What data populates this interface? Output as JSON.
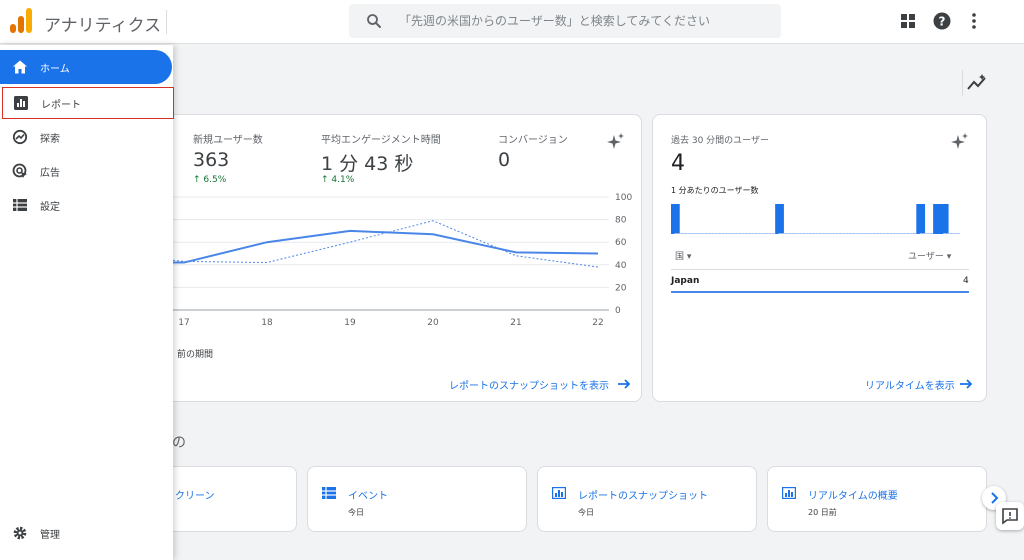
{
  "header": {
    "app_title": "アナリティクス",
    "search_placeholder": "「先週の米国からのユーザー数」と検索してみてください",
    "icons": [
      "apps-grid-icon",
      "help-icon",
      "more-vert-icon"
    ]
  },
  "sidebar": {
    "items": [
      {
        "label": "ホーム",
        "icon": "home-icon",
        "active": true
      },
      {
        "label": "レポート",
        "icon": "reports-icon",
        "highlighted": true
      },
      {
        "label": "探索",
        "icon": "explore-icon"
      },
      {
        "label": "広告",
        "icon": "advertising-icon"
      },
      {
        "label": "設定",
        "icon": "configure-icon"
      }
    ],
    "admin_label": "管理"
  },
  "overview_card": {
    "metrics": [
      {
        "label": "新規ユーザー数",
        "value": "363",
        "delta": "6.5%"
      },
      {
        "label": "平均エンゲージメント時間",
        "value": "1 分 43 秒",
        "delta": "4.1%"
      },
      {
        "label": "コンバージョン",
        "value": "0"
      }
    ],
    "legend_previous": "前の期間",
    "link": "レポートのスナップショットを表示"
  },
  "chart_data": {
    "type": "line",
    "x": [
      "17",
      "18",
      "19",
      "20",
      "21",
      "22"
    ],
    "y_ticks": [
      "100",
      "80",
      "60",
      "40",
      "20",
      "0"
    ],
    "ylim": [
      0,
      100
    ],
    "series": [
      {
        "style": "solid",
        "values": [
          42,
          60,
          70,
          67,
          51,
          50
        ]
      },
      {
        "style": "dashed",
        "values": [
          43,
          42,
          60,
          79,
          48,
          38
        ]
      }
    ],
    "x_start_value": 42,
    "x_start_value_dashed": 44,
    "color": "#4a86e8"
  },
  "realtime_card": {
    "title": "過去 30 分間のユーザー",
    "value": "4",
    "per_minute_label": "1 分あたりのユーザー数",
    "bars": [
      1,
      0,
      0,
      0,
      0,
      0,
      0,
      0,
      0,
      0,
      0,
      0,
      0,
      0,
      0,
      0,
      0,
      0,
      0,
      0,
      0,
      0,
      0,
      0,
      0,
      0,
      0,
      0,
      0,
      0,
      0,
      1,
      0,
      0,
      0,
      0,
      0,
      0,
      0,
      0,
      0,
      0,
      0,
      0,
      0,
      0,
      0,
      0,
      0,
      0,
      0,
      0,
      0,
      0,
      0,
      0,
      0,
      0,
      0,
      0,
      0,
      0,
      0,
      0,
      0,
      0,
      0,
      0,
      0,
      0,
      0,
      0,
      0,
      1,
      0,
      0,
      0,
      0,
      1,
      1,
      1,
      0,
      0,
      0,
      0,
      0
    ],
    "col_country": "国",
    "col_users": "ユーザー",
    "rows": [
      {
        "country": "Japan",
        "users": "4"
      }
    ],
    "link": "リアルタイムを表示"
  },
  "quick_access": {
    "section_title": "の",
    "cards": [
      {
        "title": "クリーン",
        "sub": "",
        "icon": ""
      },
      {
        "title": "イベント",
        "sub": "今日",
        "icon": "table-icon"
      },
      {
        "title": "レポートのスナップショット",
        "sub": "今日",
        "icon": "bar-chart-icon"
      },
      {
        "title": "リアルタイムの概要",
        "sub": "20 日前",
        "icon": "bar-chart-icon"
      }
    ]
  }
}
